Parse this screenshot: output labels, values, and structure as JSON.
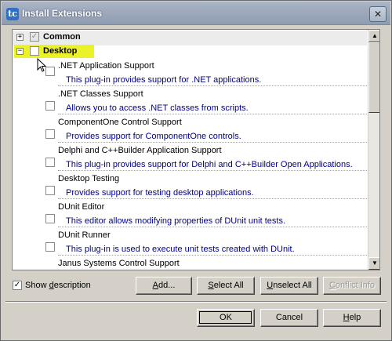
{
  "window": {
    "title": "Install Extensions",
    "app_icon_glyph": "tc",
    "close_glyph": "✕"
  },
  "groups": {
    "common": {
      "label": "Common",
      "expanded": false,
      "checked": "indeterminate"
    },
    "desktop": {
      "label": "Desktop",
      "expanded": true,
      "checked": false,
      "highlight_color": "#ecf22a"
    }
  },
  "items": [
    {
      "name": ".NET Application Support",
      "description": "This plug-in provides support for .NET applications.",
      "checked": false
    },
    {
      "name": ".NET Classes Support",
      "description": "Allows you to access .NET classes from scripts.",
      "checked": false
    },
    {
      "name": "ComponentOne Control Support",
      "description": "Provides support for ComponentOne controls.",
      "checked": false
    },
    {
      "name": "Delphi and C++Builder Application Support",
      "description": "This plug-in provides support for Delphi and C++Builder Open Applications.",
      "checked": false
    },
    {
      "name": "Desktop Testing",
      "description": "Provides support for testing desktop applications.",
      "checked": false
    },
    {
      "name": "DUnit Editor",
      "description": "This editor allows modifying properties of DUnit unit tests.",
      "checked": false
    },
    {
      "name": "DUnit Runner",
      "description": "This plug-in is used to execute unit tests created with DUnit.",
      "checked": false
    },
    {
      "name": "Janus Systems Control Support",
      "description": "",
      "checked": false
    }
  ],
  "options": {
    "show_description_label_pre": "Show ",
    "show_description_label_ul": "d",
    "show_description_label_post": "escription",
    "show_description_checked": true
  },
  "buttons": {
    "add_pre": "",
    "add_ul": "A",
    "add_post": "dd...",
    "select_all_pre": "",
    "select_all_ul": "S",
    "select_all_post": "elect All",
    "unselect_all_pre": "",
    "unselect_all_ul": "U",
    "unselect_all_post": "nselect All",
    "conflict_info_pre": "",
    "conflict_info_ul": "C",
    "conflict_info_post": "onflict Info",
    "ok": "OK",
    "cancel": "Cancel",
    "help_pre": "",
    "help_ul": "H",
    "help_post": "elp"
  },
  "icons": {
    "expand_collapsed": "+",
    "expand_expanded": "−",
    "scroll_up": "▲",
    "scroll_down": "▼",
    "check": "✓"
  }
}
